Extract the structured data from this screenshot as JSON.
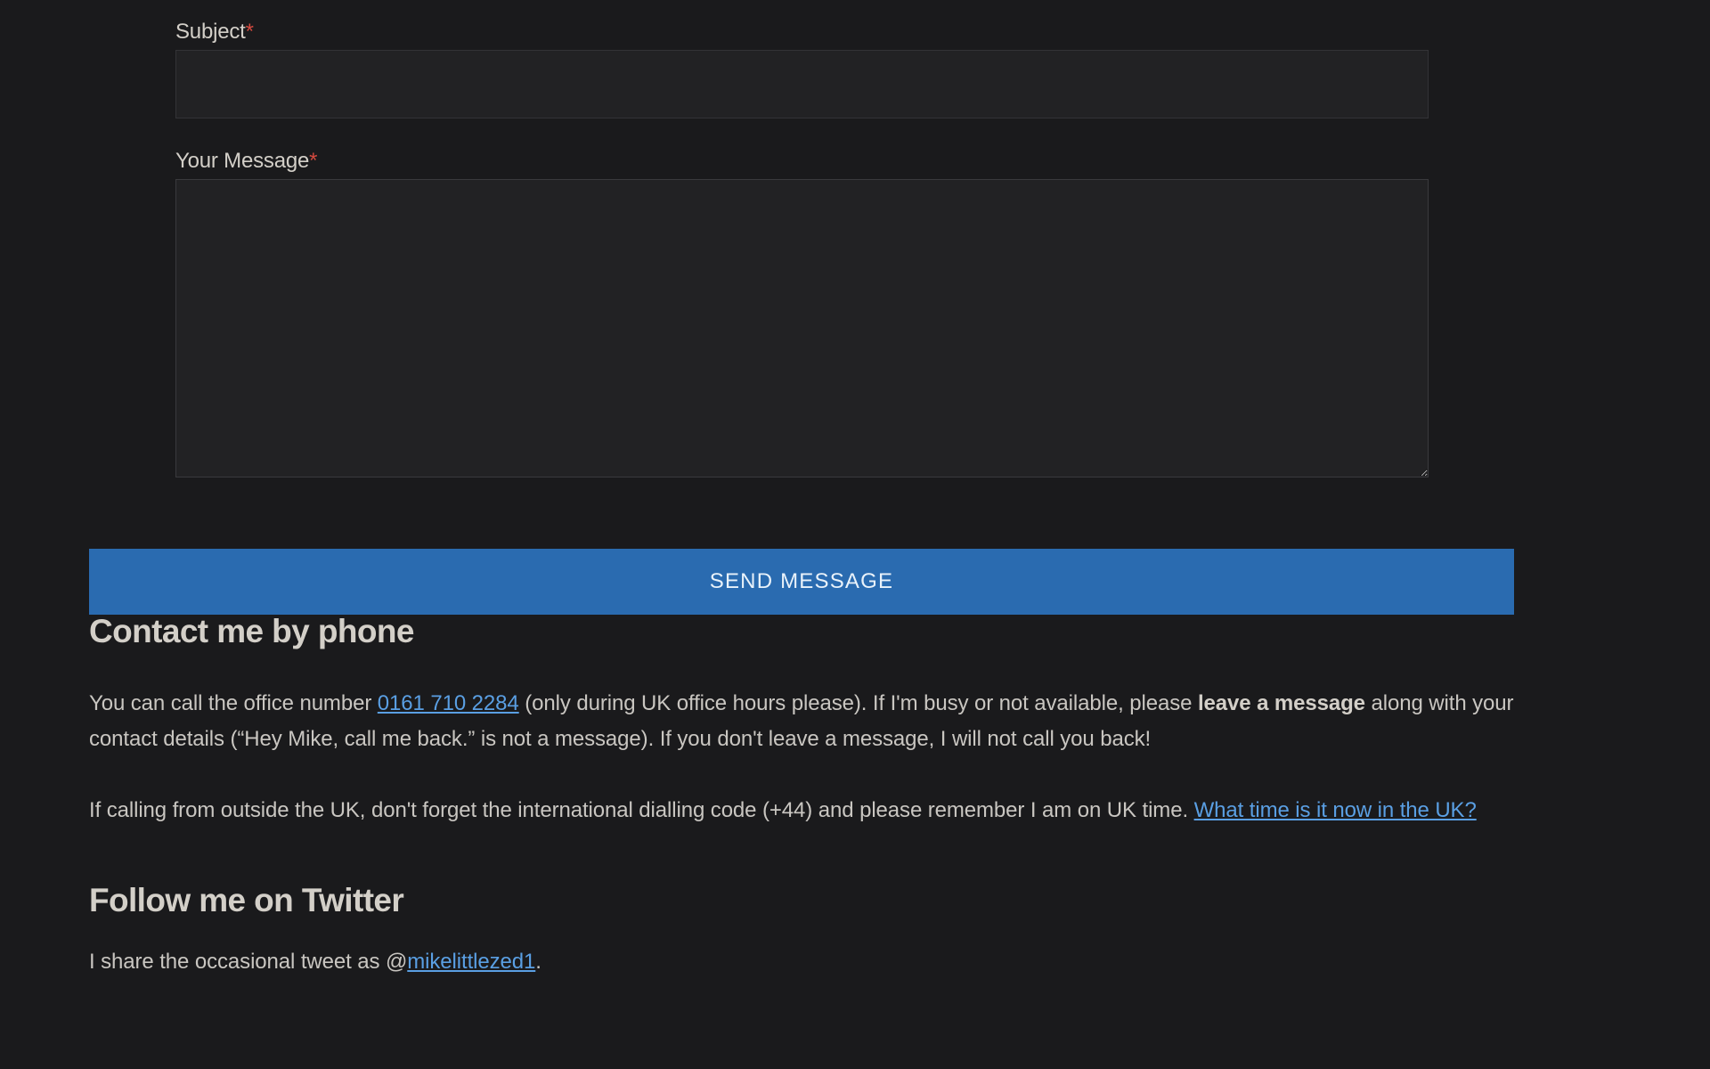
{
  "form": {
    "subject_label": "Subject",
    "message_label": "Your Message",
    "required_mark": "*",
    "subject_value": "",
    "message_value": "",
    "send_label": "SEND MESSAGE"
  },
  "phone": {
    "heading": "Contact me by phone",
    "p1_a": "You can call the office number ",
    "phone_link": "0161 710 2284",
    "p1_b": " (only during UK office hours please). If I'm busy or not available, please ",
    "bold": "leave a message",
    "p1_c": " along with your contact details (“Hey Mike, call me back.” is not a message). If you don't leave a message, I will not call you back!",
    "p2_a": "If calling from outside the UK, don't forget the international dialling code (+44) and please remember I am on UK time. ",
    "time_link": "What time is it now in the UK?"
  },
  "twitter": {
    "heading": "Follow me on Twitter",
    "p_a": "I share the  occasional tweet  as @",
    "handle": "mikelittlezed1",
    "p_b": "."
  }
}
